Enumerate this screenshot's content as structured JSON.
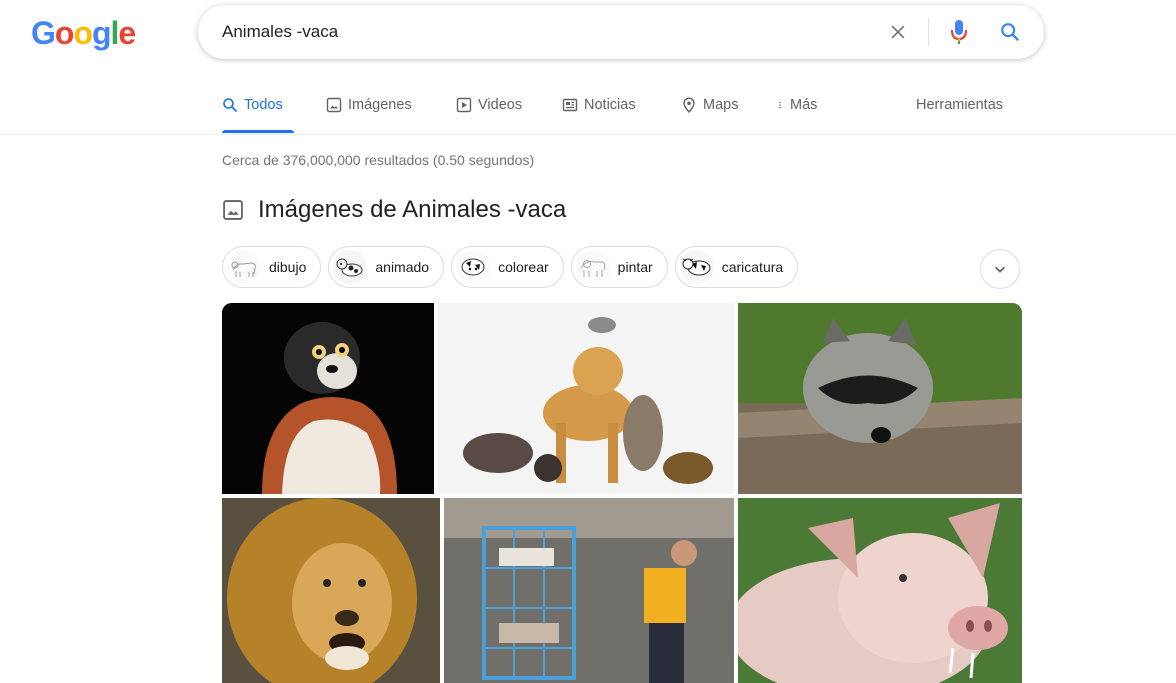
{
  "logo": {
    "letters": [
      "G",
      "o",
      "o",
      "g",
      "l",
      "e"
    ],
    "colors": [
      "#4285F4",
      "#EA4335",
      "#FBBC05",
      "#4285F4",
      "#34A853",
      "#EA4335"
    ]
  },
  "search": {
    "query": "Animales -vaca"
  },
  "tabs": [
    {
      "label": "Todos",
      "icon": "search-icon"
    },
    {
      "label": "Imágenes",
      "icon": "image-icon"
    },
    {
      "label": "Videos",
      "icon": "play-icon"
    },
    {
      "label": "Noticias",
      "icon": "news-icon"
    },
    {
      "label": "Maps",
      "icon": "map-pin-icon"
    },
    {
      "label": "Más",
      "icon": "more-vert-icon"
    }
  ],
  "tools_label": "Herramientas",
  "stats": "Cerca de 376,000,000 resultados (0.50 segundos)",
  "images_heading": "Imágenes de Animales -vaca",
  "chips": [
    "dibujo",
    "animado",
    "colorear",
    "pintar",
    "caricatura"
  ],
  "colors": {
    "accent": "#1a73e8",
    "text_secondary": "#5f6368"
  }
}
